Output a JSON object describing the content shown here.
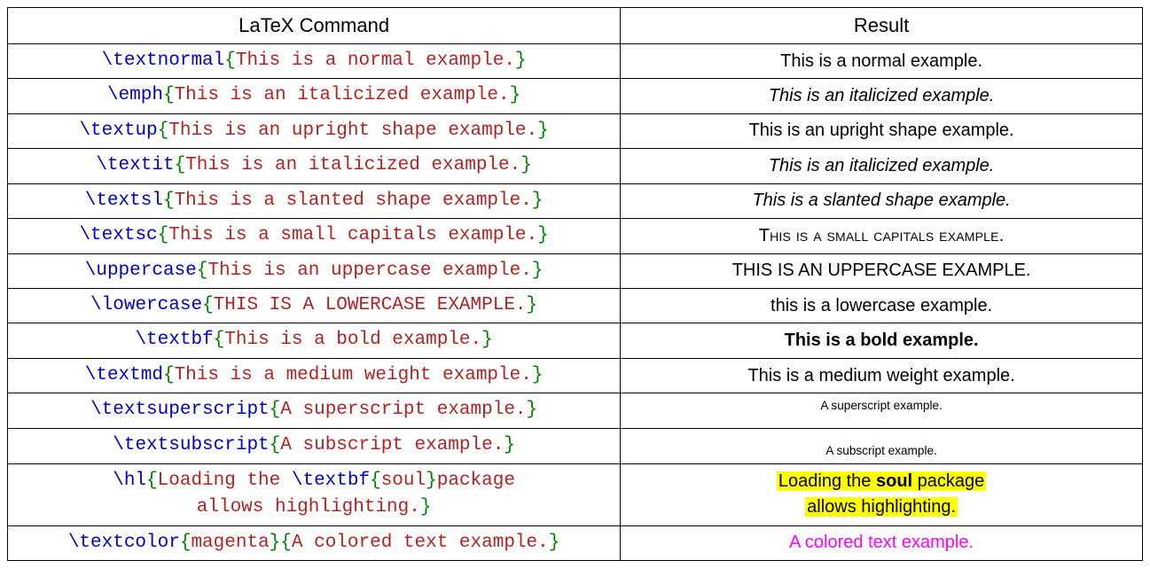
{
  "headers": {
    "cmd": "LaTeX Command",
    "res": "Result"
  },
  "rows": [
    {
      "cmd": "\\textnormal",
      "arg": "This is a normal example.",
      "result": "This is a normal example.",
      "style": "normal"
    },
    {
      "cmd": "\\emph",
      "arg": "This is an italicized example.",
      "result": "This is an italicized example.",
      "style": "italic"
    },
    {
      "cmd": "\\textup",
      "arg": "This is an upright shape example.",
      "result": "This is an upright shape example.",
      "style": "normal"
    },
    {
      "cmd": "\\textit",
      "arg": "This is an italicized example.",
      "result": "This is an italicized example.",
      "style": "italic"
    },
    {
      "cmd": "\\textsl",
      "arg": "This is a slanted shape example.",
      "result": "This is a slanted shape example.",
      "style": "slanted"
    },
    {
      "cmd": "\\textsc",
      "arg": "This is a small capitals example.",
      "result": "This is a small capitals example.",
      "style": "smallcaps"
    },
    {
      "cmd": "\\uppercase",
      "arg": "This is an uppercase example.",
      "result": "THIS IS AN UPPERCASE EXAMPLE.",
      "style": "upper"
    },
    {
      "cmd": "\\lowercase",
      "arg": "THIS IS A LOWERCASE EXAMPLE.",
      "result": "this is a lowercase example.",
      "style": "lower"
    },
    {
      "cmd": "\\textbf",
      "arg": "This is a bold example.",
      "result": "This is a bold example.",
      "style": "bold"
    },
    {
      "cmd": "\\textmd",
      "arg": "This is a medium weight example.",
      "result": "This is a medium weight example.",
      "style": "medium"
    },
    {
      "cmd": "\\textsuperscript",
      "arg": "A superscript example.",
      "result": "A superscript example.",
      "style": "sup"
    },
    {
      "cmd": "\\textsubscript",
      "arg": "A subscript example.",
      "result": "A subscript example.",
      "style": "sub"
    }
  ],
  "highlight_row": {
    "cmd1": "\\hl",
    "arg_line1_pre": "Loading the ",
    "cmd2": "\\textbf",
    "arg2": "soul",
    "arg_line1_post": "package",
    "arg_line2": "allows highlighting.",
    "result_line1_pre": "Loading the ",
    "result_bold": "soul",
    "result_line1_post": " package",
    "result_line2": "allows highlighting."
  },
  "color_row": {
    "cmd": "\\textcolor",
    "color_arg": "magenta",
    "text_arg": "A colored text example.",
    "result": "A colored text example."
  }
}
